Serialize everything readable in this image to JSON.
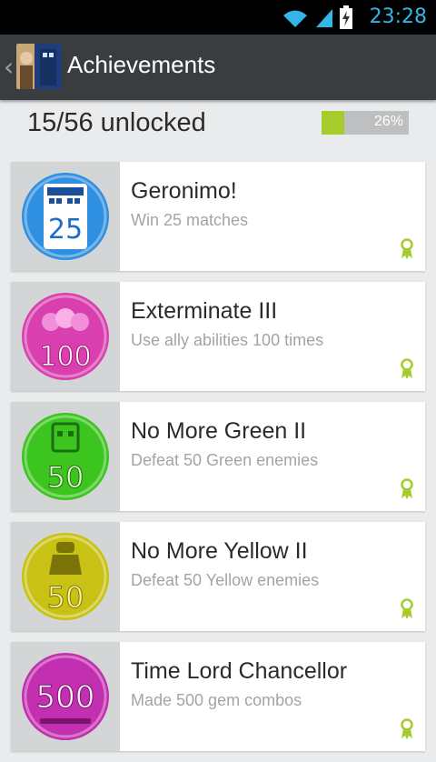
{
  "status_bar": {
    "time": "23:28"
  },
  "action_bar": {
    "title": "Achievements"
  },
  "progress": {
    "unlocked_text": "15/56 unlocked",
    "percent_text": "26%",
    "percent": 26
  },
  "achievements": [
    {
      "title": "Geronimo!",
      "description": "Win 25 matches",
      "badge_number": "25",
      "badge_color": "#2f8fe0",
      "icon": "tardis-icon"
    },
    {
      "title": "Exterminate III",
      "description": "Use ally abilities 100 times",
      "badge_number": "100",
      "badge_color": "#d93fae",
      "icon": "allies-icon"
    },
    {
      "title": "No More Green II",
      "description": "Defeat 50 Green enemies",
      "badge_number": "50",
      "badge_color": "#3cc41f",
      "icon": "cyberman-icon"
    },
    {
      "title": "No More Yellow II",
      "description": "Defeat 50 Yellow enemies",
      "badge_number": "50",
      "badge_color": "#c9c214",
      "icon": "dalek-icon"
    },
    {
      "title": "Time Lord Chancellor",
      "description": "Made 500 gem combos",
      "badge_number": "500",
      "badge_color": "#c22fb0",
      "icon": "screwdriver-icon"
    }
  ],
  "colors": {
    "accent_green": "#a5cc2c",
    "action_bar": "#3a3d3f",
    "status_blue": "#33b5e5"
  }
}
